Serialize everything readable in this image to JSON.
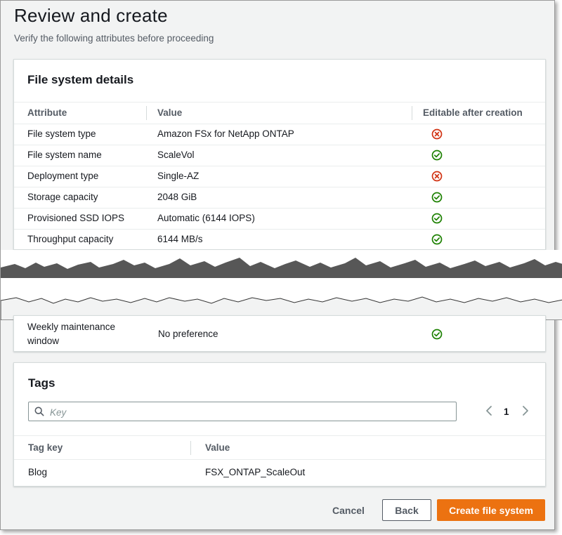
{
  "header": {
    "title": "Review and create",
    "subtitle": "Verify the following attributes before proceeding"
  },
  "file_system_details": {
    "title": "File system details",
    "columns": [
      "Attribute",
      "Value",
      "Editable after creation"
    ],
    "rows": [
      {
        "attribute": "File system type",
        "value": "Amazon FSx for NetApp ONTAP",
        "editable": "no"
      },
      {
        "attribute": "File system name",
        "value": "ScaleVol",
        "editable": "yes"
      },
      {
        "attribute": "Deployment type",
        "value": "Single-AZ",
        "editable": "no"
      },
      {
        "attribute": "Storage capacity",
        "value": "2048 GiB",
        "editable": "yes"
      },
      {
        "attribute": "Provisioned SSD IOPS",
        "value": "Automatic (6144 IOPS)",
        "editable": "yes"
      },
      {
        "attribute": "Throughput capacity",
        "value": "6144 MB/s",
        "editable": "yes"
      }
    ],
    "continued_row": {
      "attribute_line1": "Weekly maintenance",
      "attribute_line2": "window",
      "value": "No preference",
      "editable": "yes"
    }
  },
  "tags": {
    "title": "Tags",
    "search_placeholder": "Key",
    "page_number": "1",
    "columns": [
      "Tag key",
      "Value"
    ],
    "rows": [
      {
        "key": "Blog",
        "value": "FSX_ONTAP_ScaleOut"
      }
    ]
  },
  "actions": {
    "cancel": "Cancel",
    "back": "Back",
    "create": "Create file system"
  },
  "icons": {
    "editable_yes": "check-circle-icon",
    "editable_no": "x-circle-icon",
    "search": "search-icon",
    "prev": "chevron-left-icon",
    "next": "chevron-right-icon"
  },
  "colors": {
    "success": "#1d8102",
    "error": "#d13212",
    "primary": "#ec7211",
    "background": "#f2f3f3"
  }
}
